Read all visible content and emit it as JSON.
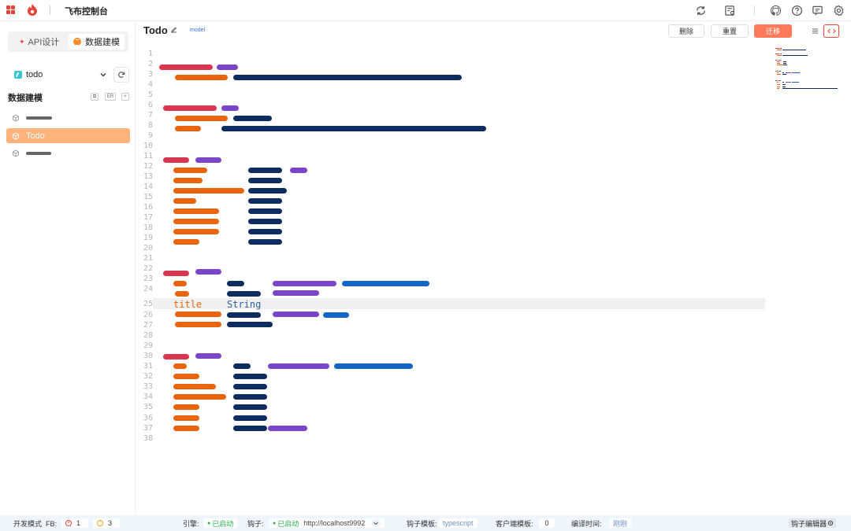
{
  "topbar": {
    "title": "飞布控制台"
  },
  "sidebar": {
    "tab_api": "API设计",
    "tab_model": "数据建模",
    "project": "todo",
    "section_title": "数据建模",
    "section_tools": [
      "⧉",
      "ER",
      "+"
    ],
    "models": [
      {
        "label": "",
        "redacted": true
      },
      {
        "label": "Todo",
        "active": true
      },
      {
        "label": "",
        "redacted": true
      }
    ]
  },
  "editor": {
    "title": "Todo",
    "tag": "model",
    "buttons": {
      "delete": "删除",
      "reset": "重置",
      "migrate": "迁移"
    },
    "line_numbers": [
      "1",
      "2",
      "3",
      "4",
      "5",
      "6",
      "7",
      "8",
      "9",
      "10",
      "11",
      "12",
      "13",
      "14",
      "15",
      "16",
      "17",
      "18",
      "19",
      "20",
      "21",
      "22",
      "23",
      "24",
      "25",
      "26",
      "27",
      "28",
      "29",
      "30",
      "31",
      "32",
      "33",
      "34",
      "35",
      "36",
      "37",
      "38"
    ],
    "visible_code": {
      "field": "title",
      "type": "String"
    }
  },
  "statusbar": {
    "mode": "开发模式",
    "fb_label": "FB:",
    "errors": "1",
    "warnings": "3",
    "engine_label": "引擎:",
    "engine_status": "已启动",
    "hook_label": "钩子:",
    "hook_status": "已启动",
    "hook_url": "http://localhost9992",
    "hook_template_label": "钩子模板:",
    "hook_template": "typescript",
    "client_template_label": "客户端模板:",
    "client_template": "0",
    "compile_label": "编译时间:",
    "compile_time": "刚刚",
    "hook_editor": "钩子编辑器"
  },
  "colors": {
    "accent": "#ff7a5a",
    "brand_red": "#e8443a",
    "active_item": "#ffb27a",
    "status_bg": "#eef5fd"
  }
}
